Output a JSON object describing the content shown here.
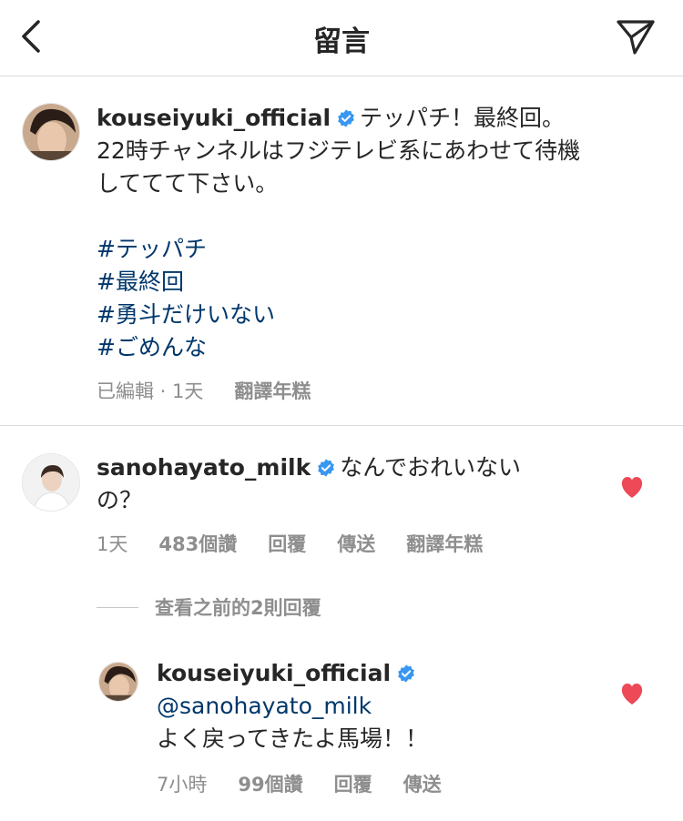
{
  "header": {
    "title": "留言"
  },
  "post": {
    "username": "kouseiyuki_official",
    "caption_line1": "テッパチ！最終回。",
    "caption_line2": "22時チャンネルはフジテレビ系にあわせて待機",
    "caption_line3": "しててて下さい。",
    "hashtags": [
      "#テッパチ",
      "#最終回",
      "#勇斗だけいない",
      "#ごめんな"
    ],
    "meta": {
      "status": "已編輯 · 1天",
      "translate": "翻譯年糕"
    }
  },
  "comment": {
    "username": "sanohayato_milk",
    "text_line1": "なんでおれいない",
    "text_line2": "の？",
    "meta": {
      "time": "1天",
      "likes": "483個讚",
      "reply": "回覆",
      "send": "傳送",
      "translate": "翻譯年糕"
    },
    "liked": true
  },
  "view_replies": {
    "label": "查看之前的2則回覆"
  },
  "reply": {
    "username": "kouseiyuki_official",
    "mention": "@sanohayato_milk",
    "text": "よく戻ってきたよ馬場！！",
    "meta": {
      "time": "7小時",
      "likes": "99個讚",
      "reply": "回覆",
      "send": "傳送"
    },
    "liked": true
  },
  "colors": {
    "heart": "#ed4956",
    "verified": "#3897f0",
    "link": "#00376b",
    "muted": "#8e8e8e"
  }
}
